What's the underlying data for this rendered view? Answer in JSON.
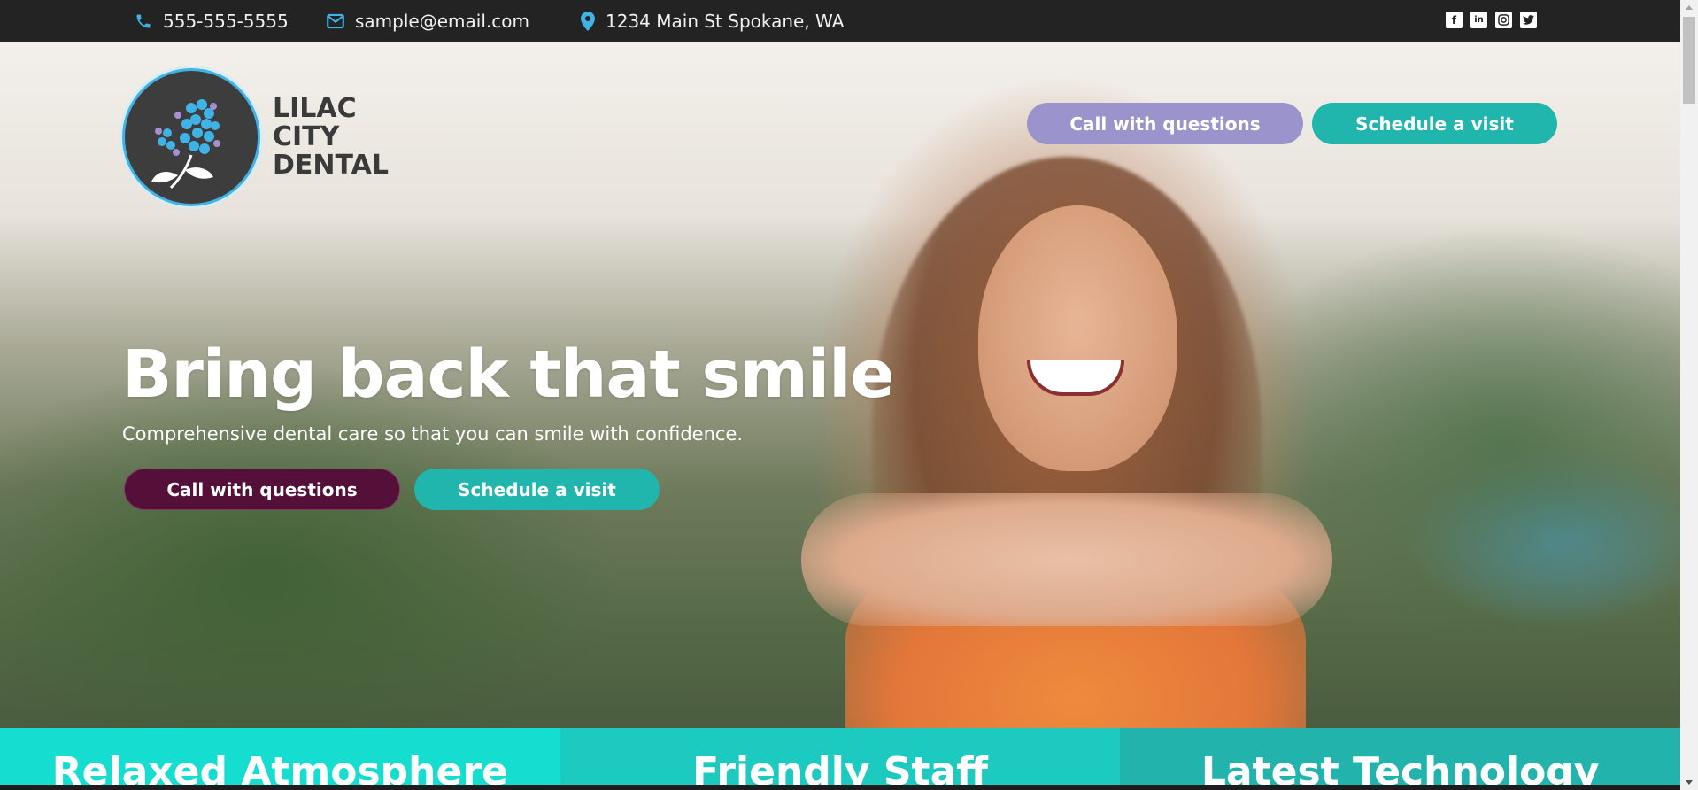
{
  "topbar": {
    "phone": "555-555-5555",
    "email": "sample@email.com",
    "address": "1234 Main St Spokane, WA",
    "social": [
      "facebook-icon",
      "linkedin-icon",
      "instagram-icon",
      "twitter-icon"
    ]
  },
  "logo": {
    "line1": "LILAC",
    "line2": "CITY",
    "line3": "DENTAL"
  },
  "header": {
    "call_label": "Call with questions",
    "visit_label": "Schedule a visit"
  },
  "hero": {
    "headline": "Bring back that smile",
    "subline": "Comprehensive dental care so that you can smile with confidence.",
    "call_label": "Call with questions",
    "visit_label": "Schedule a visit"
  },
  "features": [
    {
      "title": "Relaxed Atmosphere"
    },
    {
      "title": "Friendly Staff"
    },
    {
      "title": "Latest Technology"
    }
  ],
  "colors": {
    "topbar": "#232323",
    "accent_teal": "#21b6ad",
    "accent_lilac": "#9b93cb",
    "accent_plum": "#55103a",
    "icon_blue": "#3fb2e6"
  }
}
